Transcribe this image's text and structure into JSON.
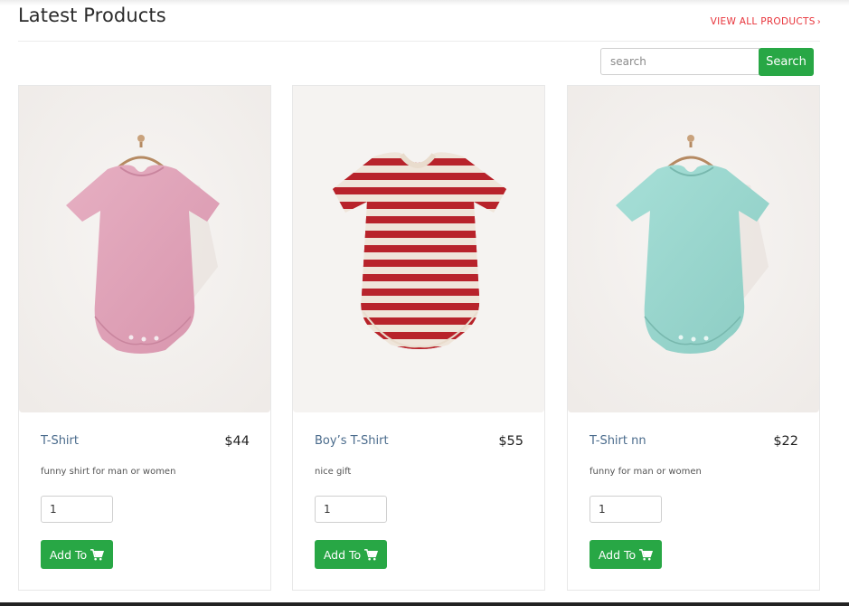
{
  "header": {
    "title": "Latest Products",
    "view_all": "VIEW ALL PRODUCTS",
    "view_all_chevron": "›"
  },
  "search": {
    "placeholder": "search",
    "button_label": "Search"
  },
  "products": [
    {
      "name": "T-Shirt",
      "price": "$44",
      "description": "funny shirt for man or women",
      "quantity": "1",
      "add_label": "Add To",
      "image": "pink-baby-bodysuit",
      "color": "#dfa3b9"
    },
    {
      "name": "Boy’s T-Shirt",
      "price": "$55",
      "description": "nice gift",
      "quantity": "1",
      "add_label": "Add To",
      "image": "red-white-striped-baby-bodysuit",
      "color": "#c0232a"
    },
    {
      "name": "T-Shirt nn",
      "price": "$22",
      "description": "funny for man or women",
      "quantity": "1",
      "add_label": "Add To",
      "image": "mint-baby-bodysuit",
      "color": "#98d6ce"
    }
  ],
  "icons": {
    "cart": "shopping-cart-icon"
  },
  "colors": {
    "accent_green": "#28a745",
    "link_red": "#e8333a",
    "product_name": "#4a6b8c"
  }
}
